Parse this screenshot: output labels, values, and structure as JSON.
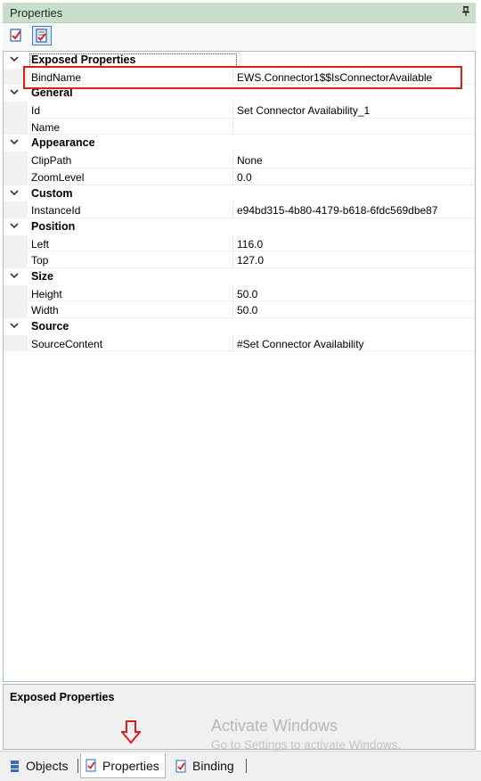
{
  "panel": {
    "title": "Properties",
    "pin_icon": "pin-icon"
  },
  "toolbar": {
    "buttons": [
      {
        "icon": "categorized-icon"
      },
      {
        "icon": "properties-page-icon",
        "active": true
      }
    ]
  },
  "grid": {
    "categories": [
      {
        "name": "Exposed Properties",
        "props": [
          {
            "name": "BindName",
            "value": "EWS.Connector1$$IsConnectorAvailable"
          }
        ]
      },
      {
        "name": "General",
        "props": [
          {
            "name": "Id",
            "value": "Set Connector Availability_1"
          },
          {
            "name": "Name",
            "value": ""
          }
        ]
      },
      {
        "name": "Appearance",
        "props": [
          {
            "name": "ClipPath",
            "value": "None"
          },
          {
            "name": "ZoomLevel",
            "value": "0.0"
          }
        ]
      },
      {
        "name": "Custom",
        "props": [
          {
            "name": "InstanceId",
            "value": "e94bd315-4b80-4179-b618-6fdc569dbe87"
          }
        ]
      },
      {
        "name": "Position",
        "props": [
          {
            "name": "Left",
            "value": "116.0"
          },
          {
            "name": "Top",
            "value": "127.0"
          }
        ]
      },
      {
        "name": "Size",
        "props": [
          {
            "name": "Height",
            "value": "50.0"
          },
          {
            "name": "Width",
            "value": "50.0"
          }
        ]
      },
      {
        "name": "Source",
        "props": [
          {
            "name": "SourceContent",
            "value": "#Set Connector Availability"
          }
        ]
      }
    ]
  },
  "description": {
    "title": "Exposed Properties"
  },
  "watermark": {
    "line1": "Activate Windows",
    "line2": "Go to Settings to activate Windows."
  },
  "tabs": [
    {
      "label": "Objects",
      "icon": "objects-icon"
    },
    {
      "label": "Properties",
      "icon": "properties-icon",
      "active": true
    },
    {
      "label": "Binding",
      "icon": "binding-icon"
    }
  ],
  "colors": {
    "titlebar": "#c9dfcb",
    "highlight": "#e01b1b",
    "accent": "#3d7ad6"
  }
}
